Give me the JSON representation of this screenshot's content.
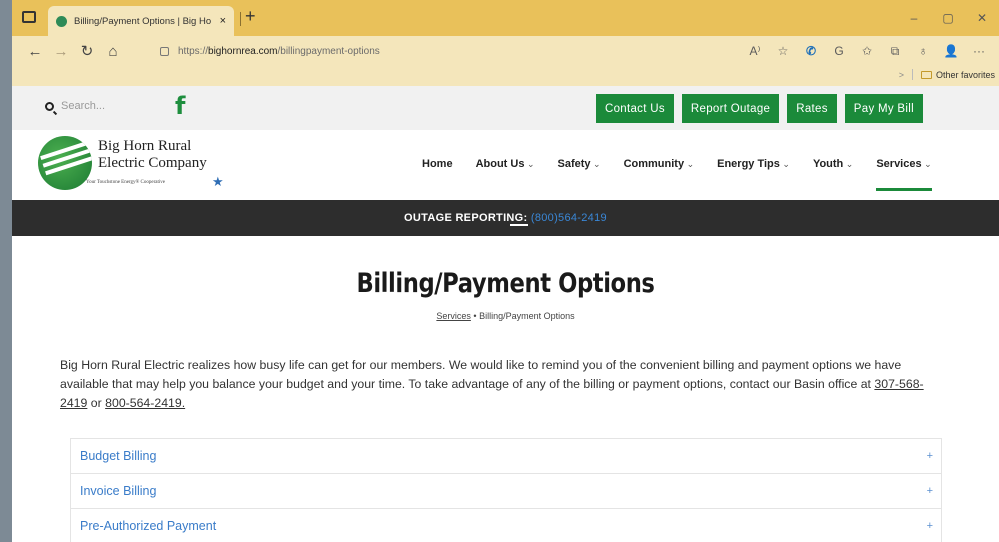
{
  "browser": {
    "tab_title": "Billing/Payment Options | Big Ho",
    "tab_close": "×",
    "new_tab": "+",
    "url_prefix": "https://",
    "url_host": "bighornrea.com",
    "url_path": "/billingpayment-options",
    "window_controls": [
      "–",
      "▢",
      "✕"
    ],
    "nav": {
      "back": "←",
      "forward": "→",
      "refresh": "↻",
      "home": "⌂"
    },
    "toolbar_icons": [
      {
        "name": "read-aloud-icon",
        "glyph": "A⁾"
      },
      {
        "name": "tracking-icon",
        "glyph": "☆"
      },
      {
        "name": "phone-icon",
        "glyph": "✆"
      },
      {
        "name": "refresh-extension-icon",
        "glyph": "G"
      },
      {
        "name": "favorites-icon",
        "glyph": "✩"
      },
      {
        "name": "collections-icon",
        "glyph": "⧉"
      },
      {
        "name": "shield-icon",
        "glyph": "♁"
      },
      {
        "name": "profile-icon",
        "glyph": "👤"
      },
      {
        "name": "more-icon",
        "glyph": "···"
      }
    ],
    "favorites_chevron": ">",
    "other_favorites": "Other favorites"
  },
  "topbar": {
    "search_placeholder": "Search...",
    "facebook_glyph": "f",
    "buttons": [
      "Contact Us",
      "Report Outage",
      "Rates",
      "Pay My Bill"
    ]
  },
  "logo": {
    "line1": "Big Horn Rural",
    "line2": "Electric Company",
    "tagline": "Your Touchstone Energy® Cooperative"
  },
  "nav": {
    "items": [
      {
        "label": "Home",
        "chevron": ""
      },
      {
        "label": "About Us",
        "chevron": " ⌄"
      },
      {
        "label": "Safety",
        "chevron": " ⌄"
      },
      {
        "label": "Community",
        "chevron": " ⌄"
      },
      {
        "label": "Energy Tips",
        "chevron": " ⌄"
      },
      {
        "label": "Youth",
        "chevron": " ⌄"
      },
      {
        "label": "Services",
        "chevron": " ⌄"
      }
    ],
    "active": "Services"
  },
  "outage": {
    "label": "OUTAGE REPORTING:",
    "phone": "(800)564-2419"
  },
  "page": {
    "title": "Billing/Payment Options",
    "breadcrumb_parent": "Services",
    "breadcrumb_sep": "•",
    "breadcrumb_current": "Billing/Payment Options",
    "intro_text": "Big Horn Rural Electric realizes how busy life can get for our members. We would like to remind you of the convenient billing and payment options we have available that may help you balance your budget and your time. To take advantage of any of the billing or payment options, contact our Basin office at",
    "phone1": "307-568-2419",
    "or": "or",
    "phone2": "800-564-2419."
  },
  "accordion": [
    {
      "label": "Budget Billing",
      "icon": "+"
    },
    {
      "label": "Invoice Billing",
      "icon": "+"
    },
    {
      "label": "Pre-Authorized Payment",
      "icon": "+"
    }
  ]
}
